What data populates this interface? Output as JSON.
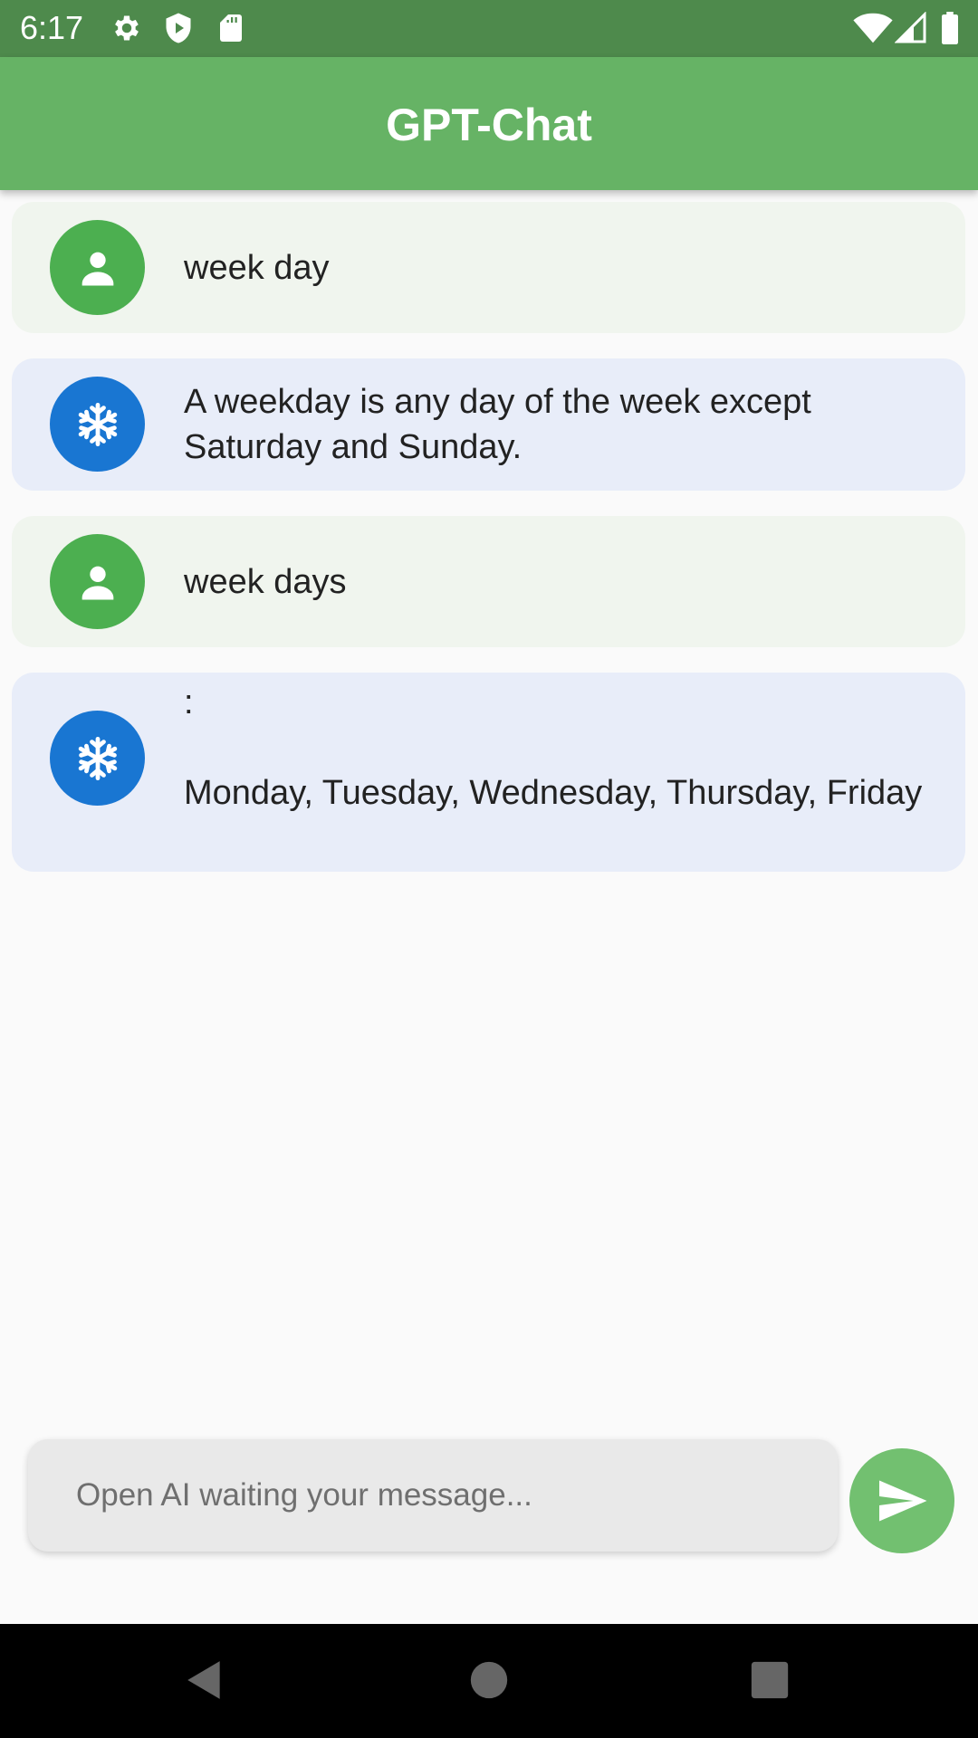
{
  "status_bar": {
    "time": "6:17",
    "icons": [
      "gear-icon",
      "shield-play-icon",
      "sd-card-icon",
      "wifi-icon",
      "signal-icon",
      "battery-icon"
    ]
  },
  "app_bar": {
    "title": "GPT-Chat"
  },
  "messages": [
    {
      "sender": "user",
      "text": "week day"
    },
    {
      "sender": "bot",
      "text": "A weekday is any day of the week except Saturday and Sunday."
    },
    {
      "sender": "user",
      "text": "week days"
    },
    {
      "sender": "bot",
      "text": ":\n\nMonday, Tuesday, Wednesday, Thursday, Friday"
    }
  ],
  "composer": {
    "placeholder": "Open AI waiting your message...",
    "value": "",
    "send_icon": "send-icon"
  },
  "nav_bar": {
    "icons": [
      "back-icon",
      "home-icon",
      "recents-icon"
    ]
  },
  "colors": {
    "status_bar": "#4e8a4c",
    "app_bar": "#66b365",
    "user_avatar": "#4caf50",
    "bot_avatar": "#1976d2",
    "user_bubble": "#f0f5ee",
    "bot_bubble": "#e8edf9",
    "send_button": "#72c070"
  }
}
